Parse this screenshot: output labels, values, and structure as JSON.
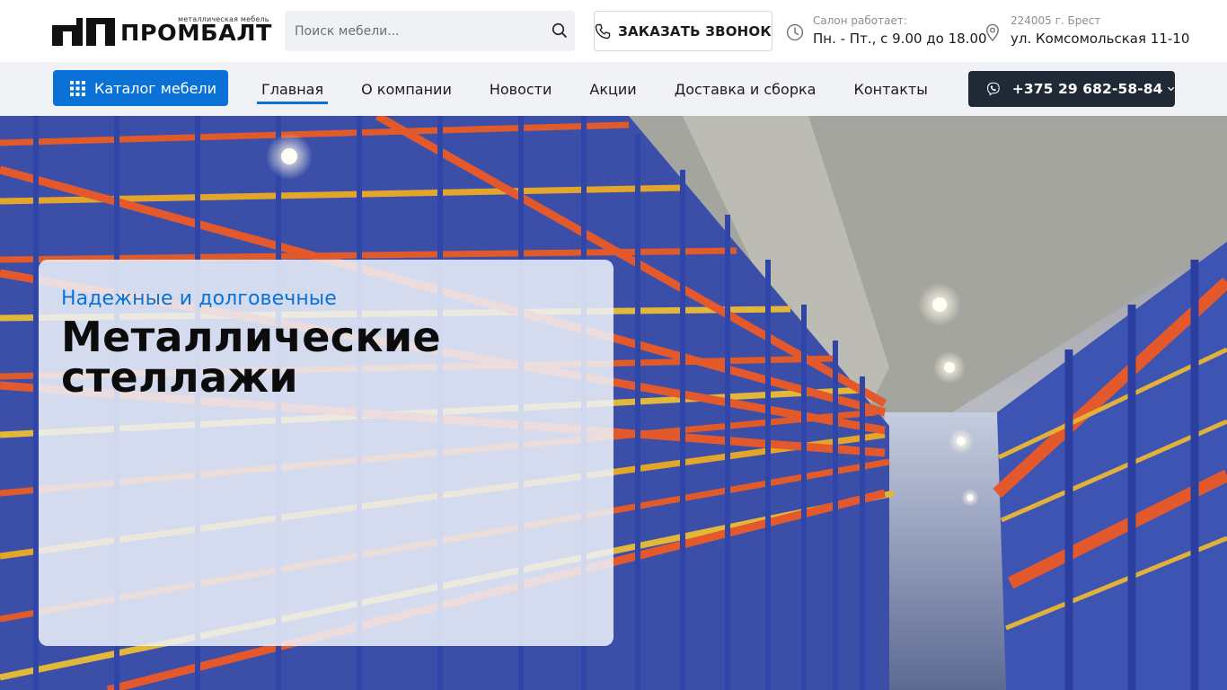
{
  "header": {
    "logo": {
      "wordmark": "ПРОМБАЛТ",
      "tagline": "металлическая мебель"
    },
    "search": {
      "placeholder": "Поиск мебели...",
      "value": ""
    },
    "callback_label": "ЗАКАЗАТЬ ЗВОНОК",
    "hours": {
      "caption": "Салон работает:",
      "value": "Пн. - Пт., с 9.00 до 18.00"
    },
    "address": {
      "caption": "224005 г. Брест",
      "value": "ул. Комсомольская 11-10"
    }
  },
  "nav": {
    "catalog_label": "Каталог мебели",
    "items": [
      {
        "label": "Главная",
        "active": true
      },
      {
        "label": "О компании",
        "active": false
      },
      {
        "label": "Новости",
        "active": false
      },
      {
        "label": "Акции",
        "active": false
      },
      {
        "label": "Доставка и сборка",
        "active": false
      },
      {
        "label": "Контакты",
        "active": false
      }
    ],
    "phone": "+375 29 682-58-84"
  },
  "hero": {
    "subtitle": "Надежные и долговечные",
    "title": "Металлические\nстеллажи"
  },
  "colors": {
    "accent": "#0a72d6",
    "dark": "#1f2a36",
    "nav_bg": "#f1f2f5"
  },
  "icons": [
    "search-icon",
    "phone-icon",
    "clock-icon",
    "location-pin-icon",
    "grid-icon",
    "viber-icon",
    "chevron-down-icon"
  ]
}
